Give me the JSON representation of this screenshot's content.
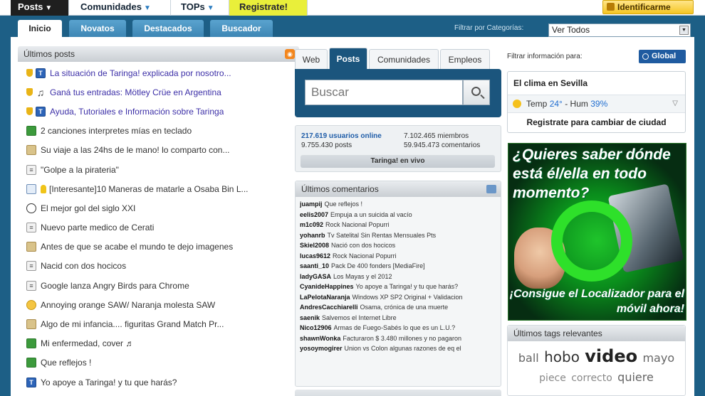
{
  "top_nav": {
    "posts": "Posts",
    "comunidades": "Comunidades",
    "tops": "TOPs",
    "registrate": "Registrate!",
    "identificarme": "Identificarme"
  },
  "tabs": {
    "inicio": "Inicio",
    "novatos": "Novatos",
    "destacados": "Destacados",
    "buscador": "Buscador"
  },
  "filter": {
    "label": "Filtrar por Categorías:",
    "selected": "Ver Todos"
  },
  "posts_box": {
    "title": "Últimos posts",
    "items": [
      {
        "title": "La situación de Taringa! explicada por nosotro...",
        "icon": "t-icon",
        "sticky": true
      },
      {
        "title": "Ganá tus entradas: Mötley Crüe en Argentina",
        "icon": "music-note-icon",
        "sticky": true
      },
      {
        "title": "Ayuda, Tutoriales e Información sobre Taringa",
        "icon": "t-icon",
        "sticky": true
      },
      {
        "title": "2 canciones interpretes mías en teclado",
        "icon": "video-icon",
        "sticky": false
      },
      {
        "title": "Su viaje a las 24hs de le mano! lo comparto con...",
        "icon": "image-icon",
        "sticky": false
      },
      {
        "title": "\"Golpe a la pirateria\"",
        "icon": "document-icon",
        "sticky": false
      },
      {
        "title": "[Interesante]10 Maneras de matarle a Osaba Bin L...",
        "icon": "book-icon",
        "sticky": false,
        "bulb": true
      },
      {
        "title": "El mejor gol del siglo XXI",
        "icon": "soccer-ball-icon",
        "sticky": false
      },
      {
        "title": "Nuevo parte medico de Cerati",
        "icon": "document-icon",
        "sticky": false
      },
      {
        "title": "Antes de que se acabe el mundo te dejo imagenes",
        "icon": "image-icon",
        "sticky": false
      },
      {
        "title": "Nacid con dos hocicos",
        "icon": "document-icon",
        "sticky": false
      },
      {
        "title": "Google lanza Angry Birds para Chrome",
        "icon": "document-icon",
        "sticky": false
      },
      {
        "title": "Annoying orange SAW/ Naranja molesta SAW",
        "icon": "smiley-icon",
        "sticky": false
      },
      {
        "title": "Algo de mi infancia.... figuritas Grand Match Pr...",
        "icon": "image-icon",
        "sticky": false
      },
      {
        "title": "Mi enfermedad, cover ♬",
        "icon": "video-icon",
        "sticky": false
      },
      {
        "title": "Que reflejos !",
        "icon": "video-icon",
        "sticky": false
      },
      {
        "title": "Yo apoye a Taringa! y tu que harás?",
        "icon": "t-icon",
        "sticky": false
      }
    ]
  },
  "search": {
    "tabs": [
      "Web",
      "Posts",
      "Comunidades",
      "Empleos"
    ],
    "active_tab": "Posts",
    "placeholder": "Buscar"
  },
  "stats": {
    "online": "217.619 usuarios online",
    "miembros": "7.102.465 miembros",
    "posts": "9.755.430 posts",
    "comentarios": "59.945.473 comentarios",
    "live_button": "Taringa! en vivo"
  },
  "comments_box": {
    "title": "Últimos comentarios",
    "items": [
      {
        "user": "juampij",
        "text": "Que reflejos !"
      },
      {
        "user": "eelis2007",
        "text": "Empuja a un suicida al vacío"
      },
      {
        "user": "m1c092",
        "text": "Rock Nacional Popurri"
      },
      {
        "user": "yohanrb",
        "text": "Tv Satelital Sin Rentas Mensuales Pts"
      },
      {
        "user": "Skiel2008",
        "text": "Nació con dos hocicos"
      },
      {
        "user": "lucas9612",
        "text": "Rock Nacional Popurri"
      },
      {
        "user": "saanti_10",
        "text": "Pack De 400 fonders [MediaFire]"
      },
      {
        "user": "ladyGASA",
        "text": "Los Mayas y el 2012"
      },
      {
        "user": "CyanideHappines",
        "text": "Yo apoye a Taringa! y tu que harás?"
      },
      {
        "user": "LaPelotaNaranja",
        "text": "Windows XP SP2 Original + Validacion"
      },
      {
        "user": "AndresCacchiarelli",
        "text": "Osama, crónica de una muerte"
      },
      {
        "user": "saenik",
        "text": "Salvemos el Internet Libre"
      },
      {
        "user": "Nico12906",
        "text": "Armas de Fuego-Sabés lo que es un L.U.?"
      },
      {
        "user": "shawnWonka",
        "text": "Facturaron $ 3.480 millones y no pagaron"
      },
      {
        "user": "yosoymogirer",
        "text": "Union vs Colon algunas razones de eq el"
      }
    ]
  },
  "right": {
    "filter_info": "Filtrar información para:",
    "global_button": "Global",
    "weather": {
      "title": "El clima en Sevilla",
      "temp_label": "Temp",
      "temp_value": "24°",
      "hum_label": "Hum",
      "hum_value": "39%",
      "register": "Registrate para cambiar de ciudad"
    },
    "ad": {
      "top_text": "¿Quieres saber dónde está él/ella en todo momento?",
      "bottom_text": "¡Consigue el Localizador para el móvil ahora!"
    },
    "tags": {
      "title": "Últimos tags relevantes",
      "items": [
        {
          "word": "ball",
          "size": "s1"
        },
        {
          "word": "hobo",
          "size": "s2"
        },
        {
          "word": "video",
          "size": "s3"
        },
        {
          "word": "mayo",
          "size": "s1"
        },
        {
          "word": "piece",
          "size": "s0"
        },
        {
          "word": "correcto",
          "size": "s0"
        },
        {
          "word": "quiere",
          "size": "s1"
        }
      ]
    }
  },
  "colors": {
    "page_bg": "#1d5f86",
    "search_panel": "#1b557d",
    "registrate_bg": "#e9ef3a",
    "link_online": "#1f5da8",
    "sticky_title": "#3c2fa7"
  }
}
